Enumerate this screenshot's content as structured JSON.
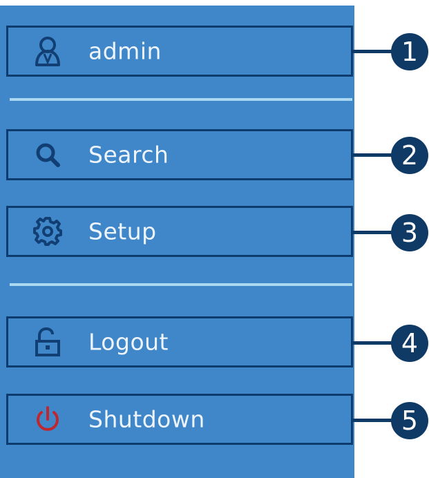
{
  "menu": {
    "items": [
      {
        "label": "admin",
        "icon": "user-icon"
      },
      {
        "label": "Search",
        "icon": "search-icon"
      },
      {
        "label": "Setup",
        "icon": "gear-icon"
      },
      {
        "label": "Logout",
        "icon": "unlock-icon"
      },
      {
        "label": "Shutdown",
        "icon": "power-icon"
      }
    ]
  },
  "callouts": [
    "1",
    "2",
    "3",
    "4",
    "5"
  ],
  "colors": {
    "panel": "#3f87c9",
    "border": "#0d3b6e",
    "divider": "#a9d8f0",
    "badge": "#0f3a66",
    "icon": "#123f73",
    "power_icon": "#c0262e"
  }
}
